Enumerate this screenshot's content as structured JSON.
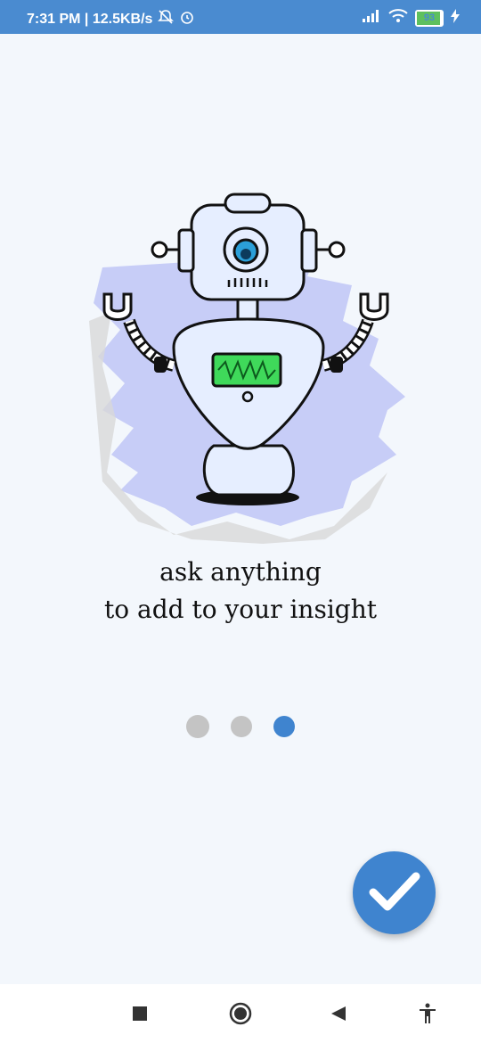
{
  "status_bar": {
    "time_speed": "7:31 PM | 12.5KB/s",
    "battery": "93",
    "icons": [
      "mute-icon",
      "alarm-icon",
      "signal-icon",
      "wifi-icon",
      "battery-icon",
      "charging-icon"
    ]
  },
  "onboarding": {
    "illustration": "robot-illustration",
    "caption_line1": "ask anything",
    "caption_line2": "to add to your insight",
    "pages": 3,
    "current_page": 3
  },
  "actions": {
    "done_icon": "check-icon"
  },
  "nav_bar": {
    "icons": [
      "recents-icon",
      "home-icon",
      "back-icon",
      "accessibility-icon"
    ]
  },
  "colors": {
    "status_bar": "#4a8bd0",
    "accent": "#3f84cf",
    "background": "#f3f7fc",
    "dot_inactive": "#c4c4c4"
  }
}
